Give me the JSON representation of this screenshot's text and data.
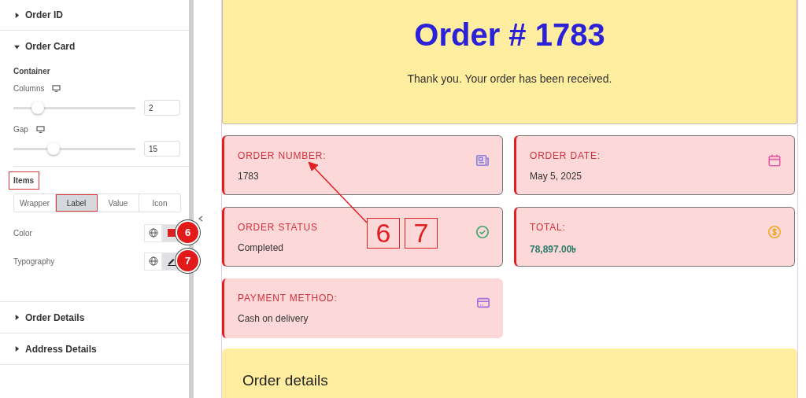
{
  "panel": {
    "sections": [
      {
        "title": "Order ID",
        "expanded": false
      },
      {
        "title": "Order Card",
        "expanded": true,
        "group": "Container",
        "sliders": [
          {
            "label": "Columns",
            "level": 0.2,
            "value": "2"
          },
          {
            "label": "Gap",
            "level": 0.33,
            "value": "15"
          }
        ],
        "subgroup": "Items",
        "tabs": [
          {
            "label": "Wrapper",
            "selected": false
          },
          {
            "label": "Label",
            "selected": true
          },
          {
            "label": "Value",
            "selected": false
          },
          {
            "label": "Icon",
            "selected": false
          }
        ],
        "controls": [
          {
            "label": "Color",
            "kind": "color",
            "color": "#e02020",
            "badge": "6"
          },
          {
            "label": "Typography",
            "kind": "typography",
            "badge": "7"
          }
        ]
      },
      {
        "title": "Order Details",
        "expanded": false
      },
      {
        "title": "Address Details",
        "expanded": false
      }
    ]
  },
  "order": {
    "title": "Order # 1783",
    "message": "Thank you. Your order has been received.",
    "cards": [
      {
        "label": "ORDER NUMBER:",
        "value": "1783",
        "kind": "receipt",
        "color": "#8b7fe0",
        "outlined": true,
        "emphasis": false
      },
      {
        "label": "ORDER DATE:",
        "value": "May 5, 2025",
        "kind": "calendar",
        "color": "#e35fa8",
        "outlined": true,
        "emphasis": false
      },
      {
        "label": "ORDER STATUS",
        "value": "Completed",
        "kind": "check",
        "color": "#3aa66a",
        "outlined": true,
        "emphasis": false
      },
      {
        "label": "TOTAL:",
        "value": "78,897.00৳",
        "kind": "dollar",
        "color": "#f0a828",
        "outlined": true,
        "emphasis": true
      },
      {
        "label": "PAYMENT METHOD:",
        "value": "Cash on delivery",
        "kind": "card",
        "color": "#a070e0",
        "outlined": false,
        "emphasis": false
      }
    ],
    "details_title": "Order details"
  },
  "callout": {
    "boxes": [
      "6",
      "7"
    ]
  }
}
